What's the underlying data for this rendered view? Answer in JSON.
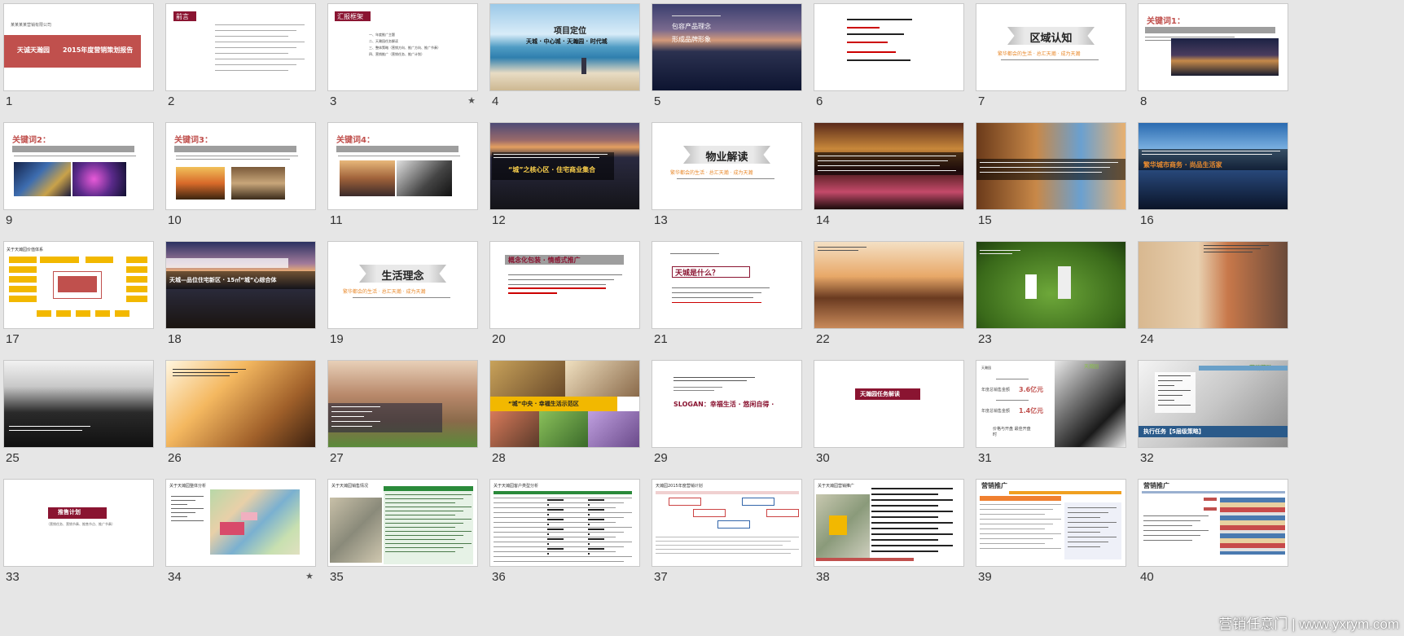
{
  "slides": [
    {
      "n": "1",
      "title_l": "天诚天瀚园",
      "title_r": "2015年度营销策划报告",
      "top": "某某某某营销有限公司"
    },
    {
      "n": "2",
      "title": "前言"
    },
    {
      "n": "3",
      "title": "汇报框架",
      "star": "★",
      "items": [
        "一、年度推广主题",
        "二、天瀚园任务解读",
        "三、整体策略（营销方向、推广方向、推广节奏）",
        "四、营销推广（营销任务、推广计划）"
      ]
    },
    {
      "n": "4",
      "title": "项目定位",
      "sub": "天城 · 中心城 · 天瀚园 · 时代城"
    },
    {
      "n": "5",
      "lines": [
        "包容产品理念",
        "形成品牌形象"
      ]
    },
    {
      "n": "6"
    },
    {
      "n": "7",
      "title": "区域认知",
      "sub": "繁华都会的生活 · 总汇天瀚 · 成为天瀚"
    },
    {
      "n": "8",
      "title": "关键词1："
    },
    {
      "n": "9",
      "title": "关键词2："
    },
    {
      "n": "10",
      "title": "关键词3："
    },
    {
      "n": "11",
      "title": "关键词4："
    },
    {
      "n": "12",
      "title": "“城”之核心区 · 住宅商业集合"
    },
    {
      "n": "13",
      "title": "物业解读",
      "sub": "繁华都会的生活 · 总汇天瀚 · 成为天瀚"
    },
    {
      "n": "14"
    },
    {
      "n": "15"
    },
    {
      "n": "16",
      "title": "繁华城市商务 · 尚品生活家"
    },
    {
      "n": "17",
      "title": "关于天瀚园价值体系"
    },
    {
      "n": "18",
      "title": "天城—品位住宅新区 · 15㎡“城”心综合体"
    },
    {
      "n": "19",
      "title": "生活理念",
      "sub": "繁华都会的生活 · 总汇天瀚 · 成为天瀚"
    },
    {
      "n": "20",
      "title": "概念化包装 · 情感式推广"
    },
    {
      "n": "21",
      "title": "天城是什么？"
    },
    {
      "n": "22"
    },
    {
      "n": "23"
    },
    {
      "n": "24"
    },
    {
      "n": "25"
    },
    {
      "n": "26"
    },
    {
      "n": "27"
    },
    {
      "n": "28",
      "title": "“城”中央 · 幸福生活示范区"
    },
    {
      "n": "29",
      "title": "SLOGAN：幸福生活 · 悠闲自得 ·"
    },
    {
      "n": "30",
      "title": "天瀚园任务解读"
    },
    {
      "n": "31",
      "title": "天瀚园",
      "sub1": "年度总销售金额",
      "v1": "3.6亿元",
      "sub2": "年度总销售金额",
      "v2": "1.4亿元",
      "bottom": "价格与开盘 最佳开盘时"
    },
    {
      "n": "32",
      "title": "营销策略",
      "sub": "执行任务【5层级策略】"
    },
    {
      "n": "33",
      "title": "推售计划",
      "sub": "（营销任务、营销节奏、推售节点、推广节奏）"
    },
    {
      "n": "34",
      "title": "关于天瀚园整体分析",
      "star": "★"
    },
    {
      "n": "35",
      "title": "关于天瀚园销售情况"
    },
    {
      "n": "36",
      "title": "关于天瀚园客户类型分析"
    },
    {
      "n": "37",
      "title": "天瀚园2015年度营销计划"
    },
    {
      "n": "38",
      "title": "关于天瀚园营销推广"
    },
    {
      "n": "39",
      "title": "营销推广"
    },
    {
      "n": "40",
      "title": "营销推广"
    }
  ],
  "watermark": "营销任意门 | www.yxrym.com",
  "colors": {
    "maroon": "#8a1431",
    "red": "#c0504d",
    "gold": "#f2b800",
    "orange": "#e98b2f",
    "canvas": "#e6e6e6"
  }
}
